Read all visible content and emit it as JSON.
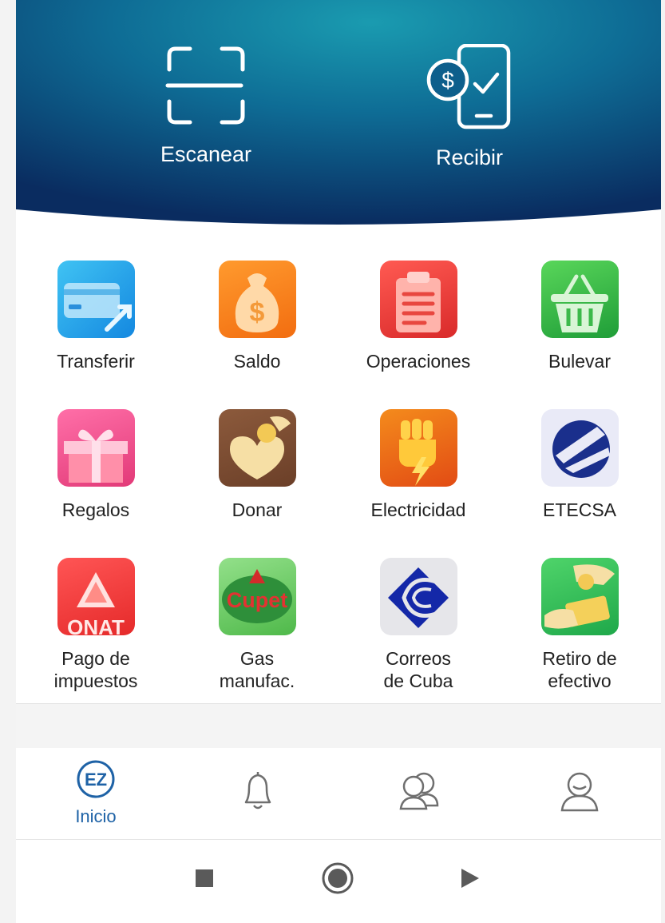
{
  "hero": {
    "scan_label": "Escanear",
    "receive_label": "Recibir"
  },
  "services": [
    {
      "label": "Transferir",
      "icon": "transfer-card-icon"
    },
    {
      "label": "Saldo",
      "icon": "money-bag-icon"
    },
    {
      "label": "Operaciones",
      "icon": "clipboard-icon"
    },
    {
      "label": "Bulevar",
      "icon": "shopping-basket-icon"
    },
    {
      "label": "Regalos",
      "icon": "gift-icon"
    },
    {
      "label": "Donar",
      "icon": "donate-heart-icon"
    },
    {
      "label": "Electricidad",
      "icon": "electric-fist-icon"
    },
    {
      "label": "ETECSA",
      "icon": "etecsa-logo"
    },
    {
      "label": "Pago de\nimpuestos",
      "icon": "onat-logo",
      "logo_text": "ONAT"
    },
    {
      "label": "Gas\nmanufac.",
      "icon": "cupet-logo",
      "logo_text": "Cupet"
    },
    {
      "label": "Correos\nde Cuba",
      "icon": "correos-logo"
    },
    {
      "label": "Retiro de\nefectivo",
      "icon": "cash-withdraw-icon"
    }
  ],
  "tabbar": {
    "active_tab": "Inicio",
    "home_logo_text": "EZ",
    "tabs": [
      {
        "label": "Inicio",
        "icon": "enzona-home-icon"
      },
      {
        "label": "",
        "icon": "bell-icon"
      },
      {
        "label": "",
        "icon": "contacts-icon"
      },
      {
        "label": "",
        "icon": "profile-icon"
      }
    ]
  },
  "system_nav": [
    "recents-icon",
    "home-icon",
    "back-icon"
  ],
  "colors": {
    "hero_dark": "#0a2f63",
    "hero_teal": "#0f7d98",
    "accent": "#1e62a6"
  }
}
